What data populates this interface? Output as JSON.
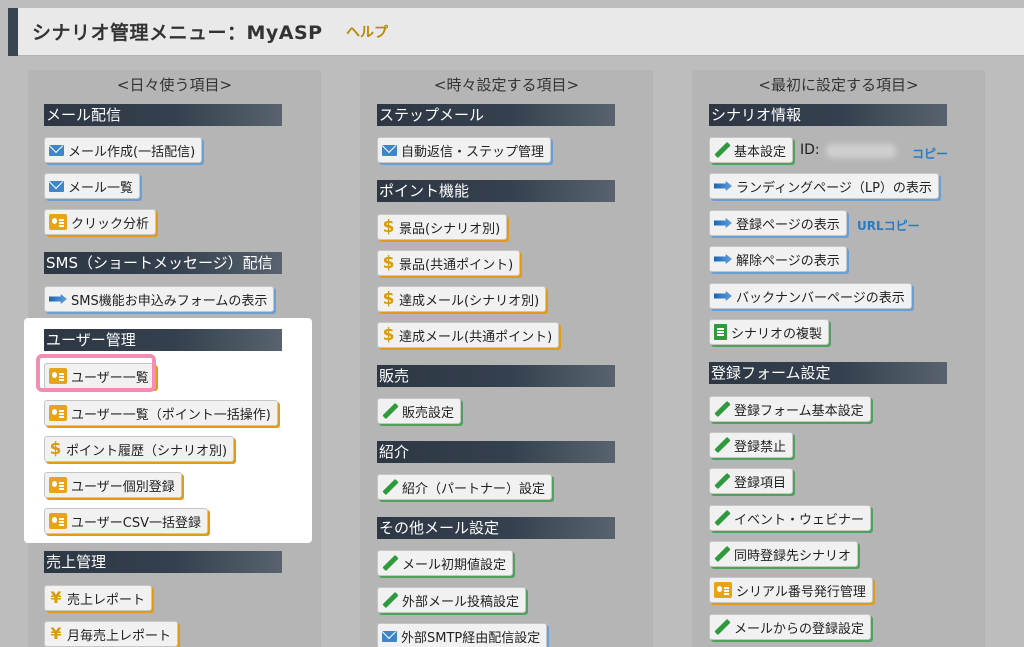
{
  "header": {
    "title": "シナリオ管理メニュー：MyASP",
    "help": "ヘルプ"
  },
  "columns": {
    "daily": {
      "title": "<日々使う項目>",
      "mail": {
        "heading": "メール配信",
        "create": "メール作成(一括配信)",
        "list": "メール一覧",
        "click": "クリック分析"
      },
      "sms": {
        "heading": "SMS（ショートメッセージ）配信",
        "form": "SMS機能お申込みフォームの表示"
      },
      "user": {
        "heading": "ユーザー管理",
        "list": "ユーザー一覧",
        "list_points": "ユーザー一覧（ポイント一括操作)",
        "points_history": "ポイント履歴（シナリオ別)",
        "register": "ユーザー個別登録",
        "csv": "ユーザーCSV一括登録"
      },
      "sales": {
        "heading": "売上管理",
        "report": "売上レポート",
        "monthly": "月毎売上レポート"
      }
    },
    "sometimes": {
      "title": "<時々設定する項目>",
      "step": {
        "heading": "ステップメール",
        "auto": "自動返信・ステップ管理"
      },
      "point": {
        "heading": "ポイント機能",
        "prize_scenario": "景品(シナリオ別)",
        "prize_common": "景品(共通ポイント)",
        "achieve_scenario": "達成メール(シナリオ別)",
        "achieve_common": "達成メール(共通ポイント)"
      },
      "sale": {
        "heading": "販売",
        "settings": "販売設定"
      },
      "intro": {
        "heading": "紹介",
        "partner": "紹介（パートナー）設定"
      },
      "other": {
        "heading": "その他メール設定",
        "initial": "メール初期値設定",
        "external": "外部メール投稿設定",
        "smtp": "外部SMTP経由配信設定"
      }
    },
    "first": {
      "title": "<最初に設定する項目>",
      "scenario": {
        "heading": "シナリオ情報",
        "basic": "基本設定",
        "id_label": "ID:",
        "copy": "コピー",
        "lp": "ランディングページ（LP）の表示",
        "register_page": "登録ページの表示",
        "url_copy": "URLコピー",
        "cancel_page": "解除ページの表示",
        "backnumber": "バックナンバーページの表示",
        "duplicate": "シナリオの複製"
      },
      "form": {
        "heading": "登録フォーム設定",
        "basic": "登録フォーム基本設定",
        "ban": "登録禁止",
        "items": "登録項目",
        "event": "イベント・ウェビナー",
        "simultaneous": "同時登録先シナリオ",
        "serial": "シリアル番号発行管理",
        "from_mail": "メールからの登録設定"
      }
    }
  }
}
